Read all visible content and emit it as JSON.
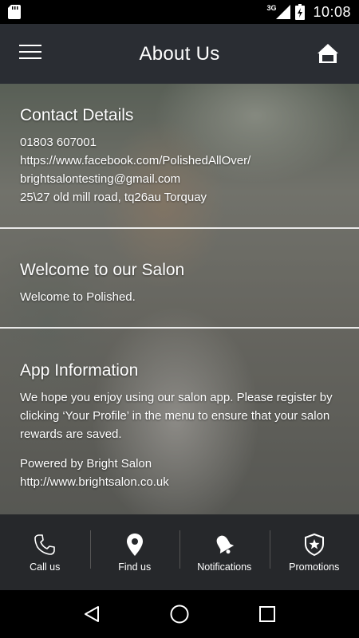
{
  "status_bar": {
    "network": "3G",
    "time": "10:08"
  },
  "header": {
    "title": "About Us"
  },
  "sections": {
    "contact": {
      "title": "Contact Details",
      "phone": "01803 607001",
      "facebook": "https://www.facebook.com/PolishedAllOver/",
      "email": "brightsalontesting@gmail.com",
      "address": "25\\27 old mill road, tq26au Torquay"
    },
    "welcome": {
      "title": "Welcome to our Salon",
      "text": "Welcome to Polished."
    },
    "app_info": {
      "title": "App Information",
      "text": "We hope you enjoy using our salon app. Please register by clicking ‘Your Profile’ in the menu to ensure that your salon rewards are saved.",
      "powered_by": "Powered by Bright Salon",
      "website": "http://www.brightsalon.co.uk"
    }
  },
  "bottom_nav": [
    {
      "label": "Call us",
      "icon": "phone-icon"
    },
    {
      "label": "Find us",
      "icon": "map-pin-icon"
    },
    {
      "label": "Notifications",
      "icon": "bell-icon"
    },
    {
      "label": "Promotions",
      "icon": "star-shield-icon"
    }
  ],
  "colors": {
    "app_bar": "#2a2d33",
    "bottom_nav": "#26282b",
    "text": "#ffffff"
  }
}
